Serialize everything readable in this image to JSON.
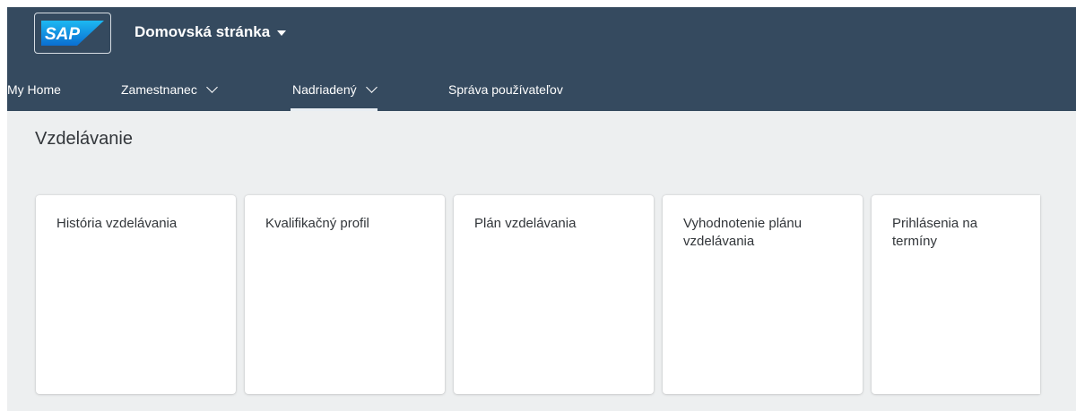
{
  "header": {
    "logo_text": "SAP",
    "app_title": "Domovská stránka",
    "caret_icon": "caret-down-icon",
    "background": "#354a5f"
  },
  "nav": {
    "tabs": [
      {
        "label": "My Home",
        "has_menu": false,
        "selected": false
      },
      {
        "label": "Zamestnanec",
        "has_menu": true,
        "selected": false
      },
      {
        "label": "Nadriadený",
        "has_menu": true,
        "selected": true
      },
      {
        "label": "Správa používateľov",
        "has_menu": false,
        "selected": false
      }
    ],
    "menu_icon": "chevron-down-icon"
  },
  "section": {
    "title": "Vzdelávanie"
  },
  "tiles": [
    {
      "title": "História vzdelávania"
    },
    {
      "title": "Kvalifikačný profil"
    },
    {
      "title": "Plán vzdelávania"
    },
    {
      "title": "Vyhodnotenie plánu vzdelávania"
    },
    {
      "title": "Prihlásenia na termíny"
    }
  ],
  "colors": {
    "shell_background": "#354a5f",
    "page_background": "#edeff0",
    "logo_blue": "#0a6ed1",
    "text": "#32363a"
  }
}
